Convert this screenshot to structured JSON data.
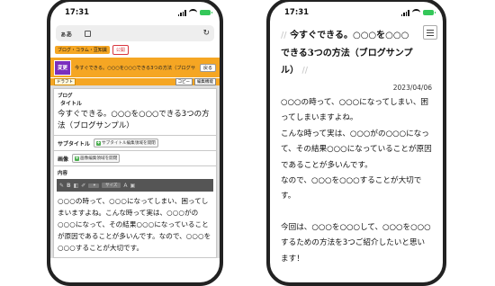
{
  "left_phone": {
    "status_time": "17:31",
    "url_aa": "ぁあ",
    "breadcrumb_tag": "ブログ・コラム・豆知識",
    "unpublished_tag": "公開",
    "change_button": "変更",
    "orange_title": "今すぐできる。○○○を○○○できる3つの方法（ブログサンプル）",
    "back_button": "戻る",
    "draft_tag": "ドラフト",
    "copy_button": "コピー",
    "edit_switch": "編集機能",
    "blog_label": "ブログ",
    "title_label": "タイトル",
    "title_text": "今すぐできる。○○○を○○○できる3つの方法（ブログサンプル）",
    "subtitle_label": "サブタイトル",
    "subtitle_button": "サブタイトル編集領域を開閉",
    "image_label": "画像",
    "image_button": "画像編集領域を開閉",
    "content_label": "内容",
    "toolbar_size_label": "サイズ",
    "content_text": "○○○の時って、○○○になってしまい、困ってしまいますよね。こんな時って実は、○○○がの○○○になって、その結果○○○になっていることが原因であることが多いんです。なので、○○○を○○○することが大切です。"
  },
  "right_phone": {
    "status_time": "17:31",
    "title": "今すぐできる。○○○を○○○できる3つの方法（ブログサンプル）",
    "date": "2023/04/06",
    "body": [
      "○○○の時って、○○○になってしまい、困ってしまいますよね。",
      "こんな時って実は、○○○がの○○○になって、その結果○○○になっていることが原因であることが多いんです。",
      "なので、○○○を○○○することが大切です。",
      "",
      "今回は、○○○を○○○して、○○○を○○○するための方法を3つご紹介したいと思います！"
    ]
  },
  "colors": {
    "accent_orange": "#f5a623",
    "change_purple": "#7b2fbe",
    "battery_green": "#34c759"
  }
}
